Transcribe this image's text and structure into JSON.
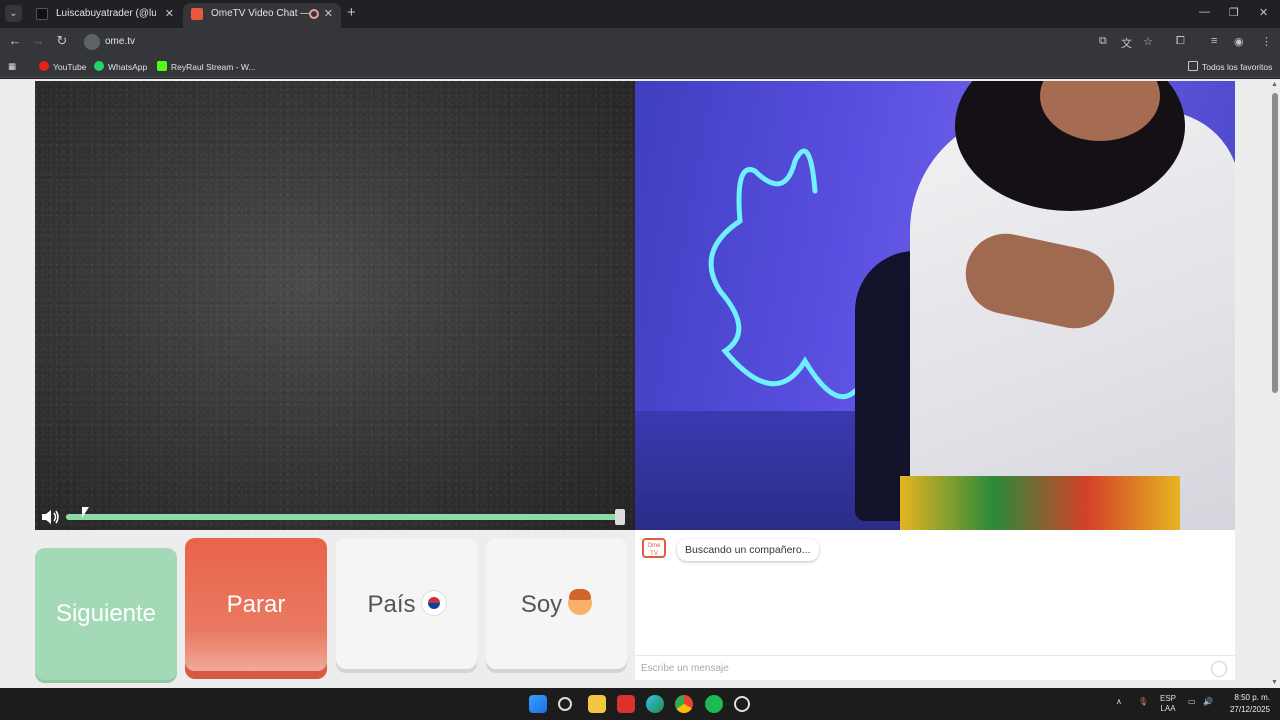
{
  "browser": {
    "tabs": [
      {
        "title": "Luiscabuyatrader (@luiscaforex",
        "active": false
      },
      {
        "title": "OmeTV Video Chat — Ome",
        "active": true
      }
    ],
    "url": "ome.tv",
    "bookmarks": [
      "YouTube",
      "WhatsApp",
      "ReyRaul Stream - W..."
    ],
    "all_bookmarks": "Todos los favoritos"
  },
  "page": {
    "volume_level": 1.0,
    "buttons": {
      "next": "Siguiente",
      "stop": "Parar",
      "country": "País",
      "gender": "Soy"
    },
    "chat": {
      "logo_text": "Ome TV",
      "status_message": "Buscando un compañero...",
      "input_placeholder": "Escribe un mensaje"
    }
  },
  "taskbar": {
    "language": "ESP",
    "layout": "LAA",
    "time": "8:50 p. m.",
    "date": "27/12/2025"
  },
  "colors": {
    "next_button": "#a3d9b6",
    "stop_button": "#e8634a",
    "volume_track": "#8ddaa8",
    "ome_brand": "#e9573f"
  },
  "icons": [
    "speaker-icon",
    "korea-flag-icon",
    "boy-emoji-icon",
    "smiley-icon",
    "ome-logo"
  ]
}
